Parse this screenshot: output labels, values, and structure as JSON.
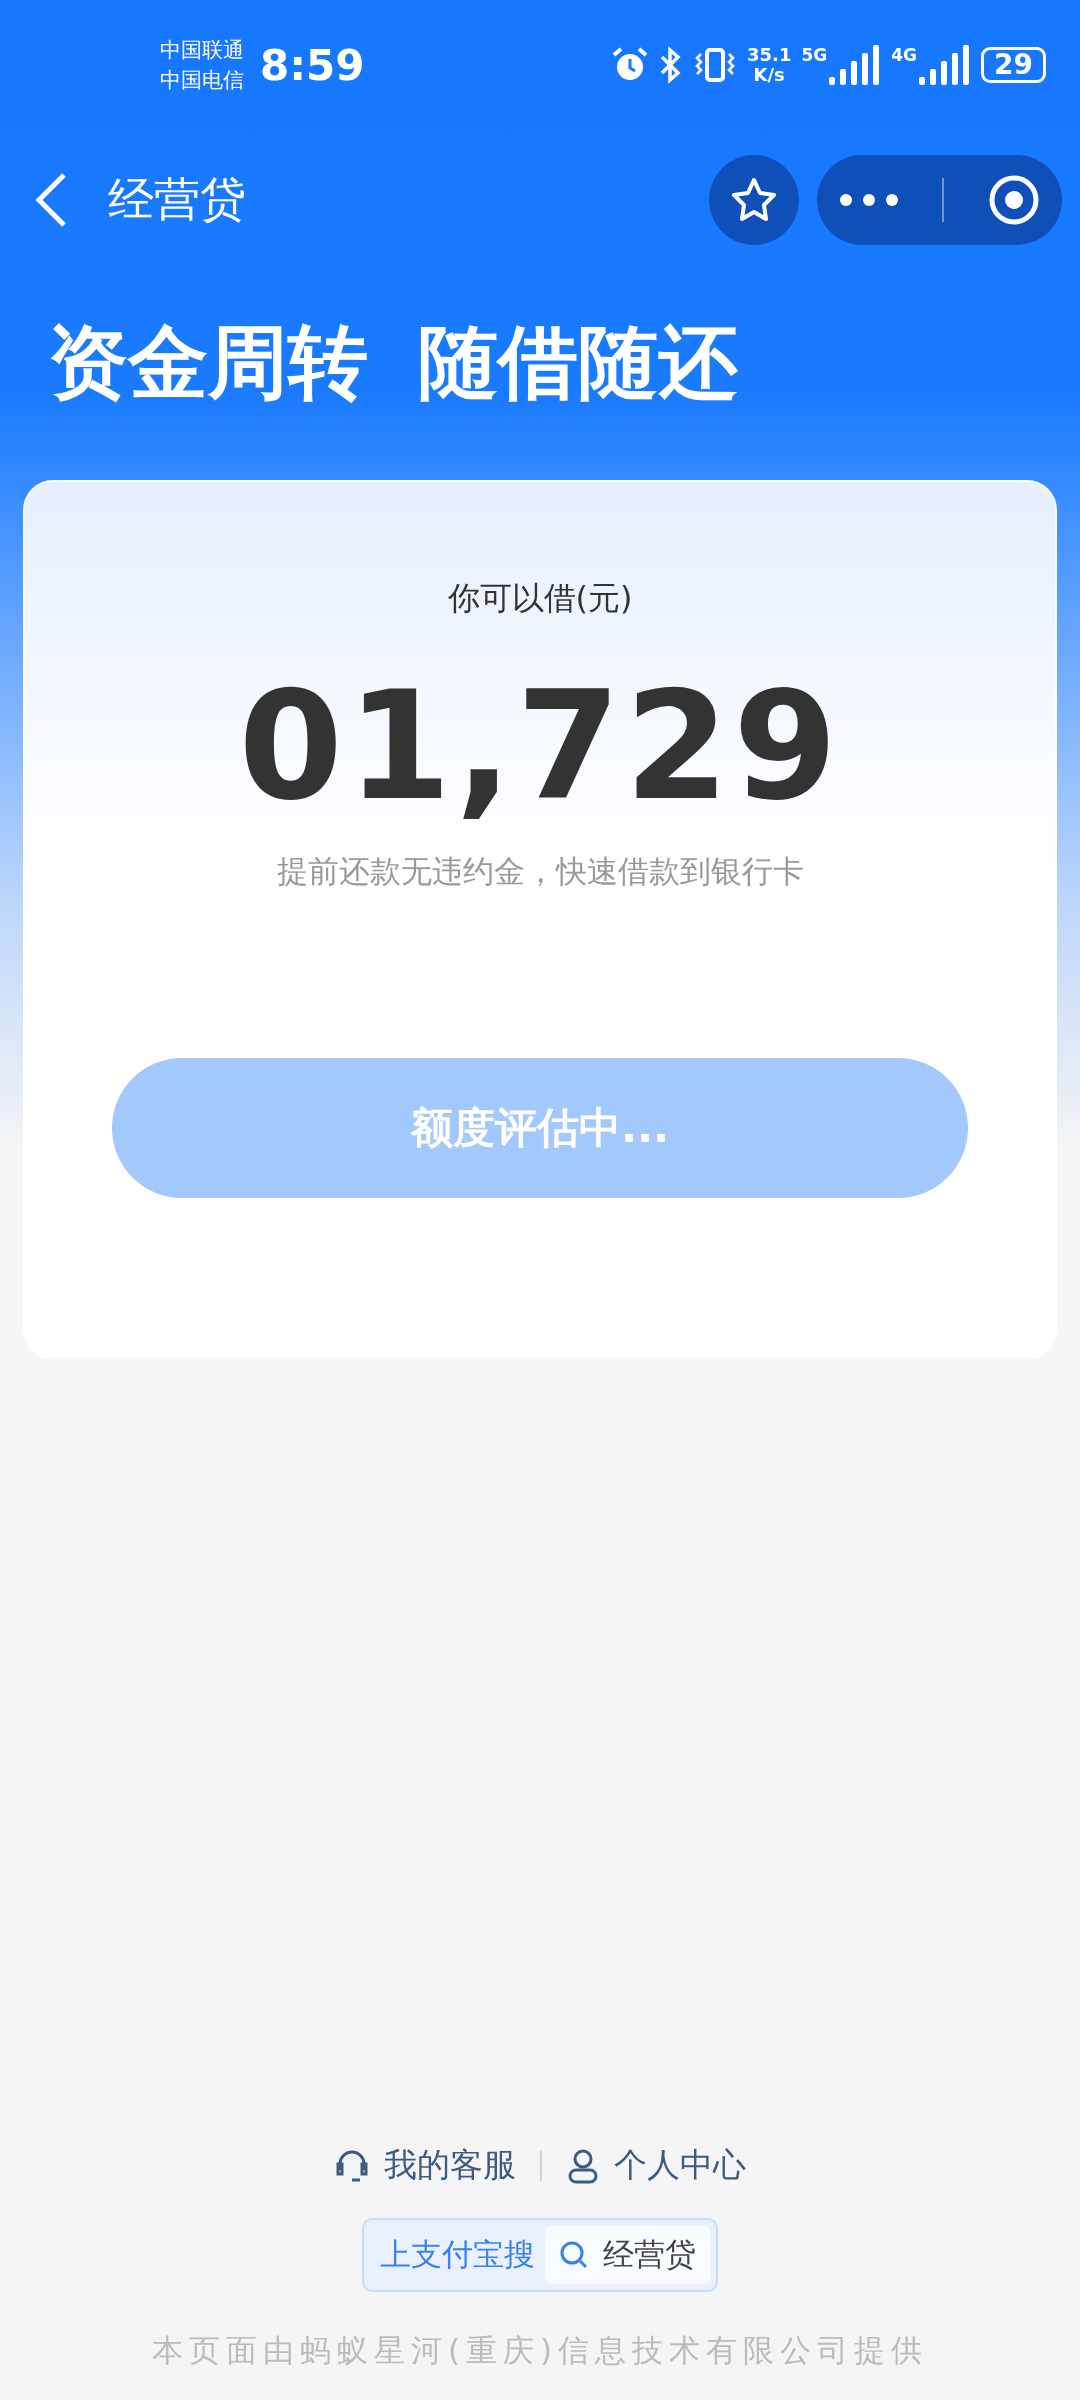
{
  "status_bar": {
    "carriers": [
      "中国联通",
      "中国电信"
    ],
    "time": "8:59",
    "net_speed": [
      "35.1",
      "K/s"
    ],
    "networks": [
      "5G",
      "4G"
    ],
    "battery": "29"
  },
  "nav": {
    "title": "经营贷"
  },
  "headline": [
    "资金周转",
    "随借随还"
  ],
  "card": {
    "label": "你可以借(元)",
    "amount": "01,729",
    "note": "提前还款无违约金，快速借款到银行卡",
    "button": {
      "label": "额度评估中...",
      "disabled": true
    }
  },
  "footer": {
    "links": [
      {
        "kind": "service",
        "label": "我的客服"
      },
      {
        "kind": "profile",
        "label": "个人中心"
      }
    ],
    "search": {
      "prefix": "上支付宝搜",
      "query": "经营贷"
    },
    "copyright": "本页面由蚂蚁星河(重庆)信息技术有限公司提供"
  }
}
